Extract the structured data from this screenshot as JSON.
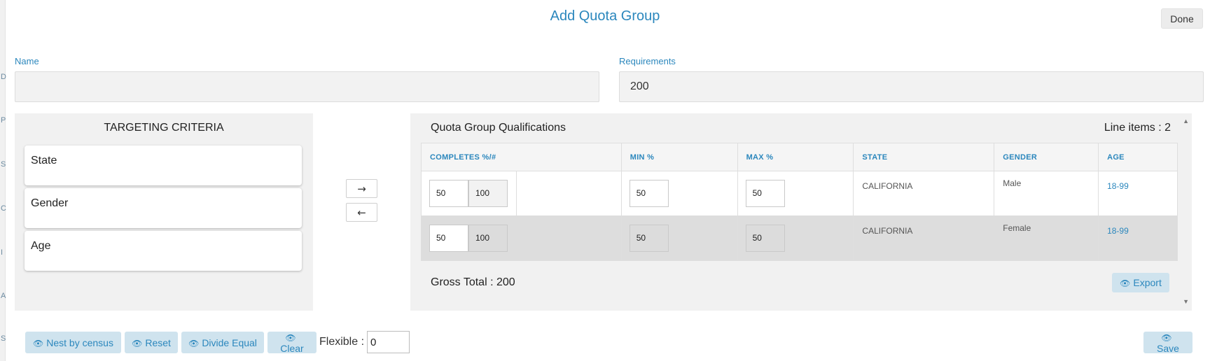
{
  "left_strip": [
    "D",
    "P",
    "S",
    "C",
    "I",
    "A",
    "S"
  ],
  "title": "Add Quota Group",
  "done_label": "Done",
  "name_field": {
    "label": "Name",
    "value": ""
  },
  "requirements_field": {
    "label": "Requirements",
    "value": "200"
  },
  "targeting": {
    "title": "TARGETING CRITERIA",
    "items": [
      "State",
      "Gender",
      "Age"
    ]
  },
  "arrows": {
    "right": "→",
    "left": "←"
  },
  "quals": {
    "title": "Quota Group Qualifications",
    "line_items_label": "Line items : 2",
    "columns": [
      "COMPLETES %/#",
      "MIN %",
      "MAX %",
      "STATE",
      "GENDER",
      "AGE"
    ],
    "rows": [
      {
        "pct": "50",
        "count": "100",
        "min": "50",
        "max": "50",
        "state": "CALIFORNIA",
        "gender": "Male",
        "age": "18-99"
      },
      {
        "pct": "50",
        "count": "100",
        "min": "50",
        "max": "50",
        "state": "CALIFORNIA",
        "gender": "Female",
        "age": "18-99"
      }
    ],
    "gross_total": "Gross Total : 200",
    "export_label": "Export"
  },
  "bottom": {
    "nest_label": "Nest by census",
    "reset_label": "Reset",
    "divide_label": "Divide Equal",
    "clear_label": "Clear",
    "flexible_label": "Flexible :",
    "flexible_value": "0",
    "save_label": "Save"
  },
  "colors": {
    "accent": "#2b87bd",
    "button_bg": "#cfe3ee",
    "panel_bg": "#f1f1f1"
  },
  "icons": {
    "button_icon": "eye-icon",
    "scroll_up": "triangle-up-icon",
    "scroll_down": "triangle-down-icon"
  }
}
